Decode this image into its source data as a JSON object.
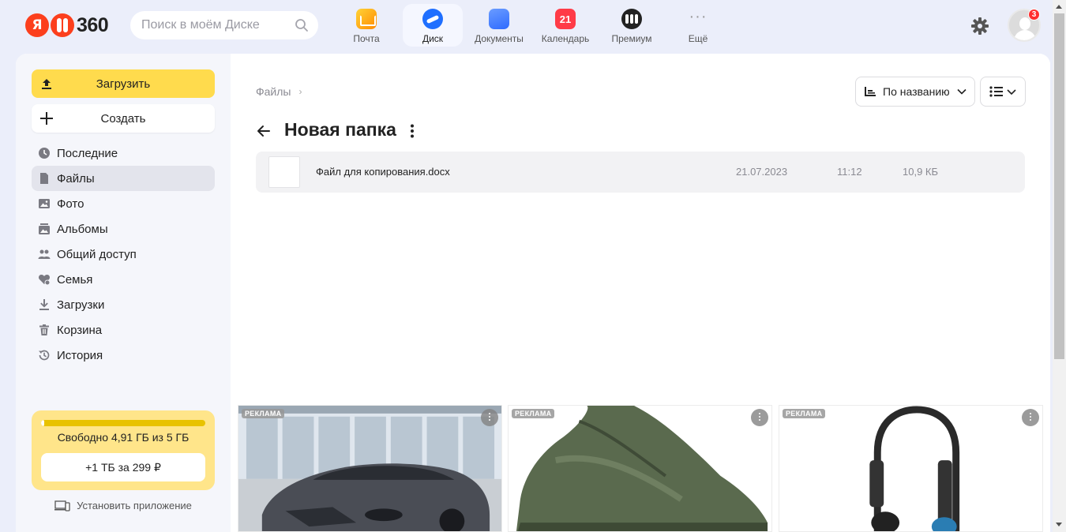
{
  "header": {
    "search_placeholder": "Поиск в моём Диске",
    "apps": [
      {
        "label": "Почта",
        "icon": "mail-icon"
      },
      {
        "label": "Диск",
        "icon": "disk-icon"
      },
      {
        "label": "Документы",
        "icon": "documents-icon"
      },
      {
        "label": "Календарь",
        "icon": "calendar-icon",
        "badge": "21"
      },
      {
        "label": "Премиум",
        "icon": "premium-icon"
      },
      {
        "label": "Ещё",
        "icon": "more-icon"
      }
    ],
    "notification_count": "3",
    "accent": "#ffdb4d"
  },
  "sidebar": {
    "upload_label": "Загрузить",
    "create_label": "Создать",
    "items": [
      {
        "label": "Последние",
        "icon": "clock-icon"
      },
      {
        "label": "Файлы",
        "icon": "file-icon",
        "active": true
      },
      {
        "label": "Фото",
        "icon": "photo-icon"
      },
      {
        "label": "Альбомы",
        "icon": "albums-icon"
      },
      {
        "label": "Общий доступ",
        "icon": "shared-icon"
      },
      {
        "label": "Семья",
        "icon": "family-icon"
      },
      {
        "label": "Загрузки",
        "icon": "download-icon"
      },
      {
        "label": "Корзина",
        "icon": "trash-icon"
      },
      {
        "label": "История",
        "icon": "history-icon"
      }
    ],
    "storage": {
      "used_fraction": 0.018,
      "text": "Свободно 4,91 ГБ из 5 ГБ",
      "upgrade_label": "+1 ТБ за 299 ₽"
    },
    "install_label": "Установить приложение"
  },
  "main": {
    "breadcrumb": "Файлы",
    "sort_label": "По названию",
    "title": "Новая папка",
    "files": [
      {
        "name": "Файл для копирования.docx",
        "date": "21.07.2023",
        "time": "11:12",
        "size": "10,9 КБ"
      }
    ]
  },
  "ads": [
    {
      "label": "РЕКЛАМА",
      "subject": "car"
    },
    {
      "label": "РЕКЛАМА",
      "subject": "boots"
    },
    {
      "label": "РЕКЛАМА",
      "subject": "headphones"
    }
  ]
}
